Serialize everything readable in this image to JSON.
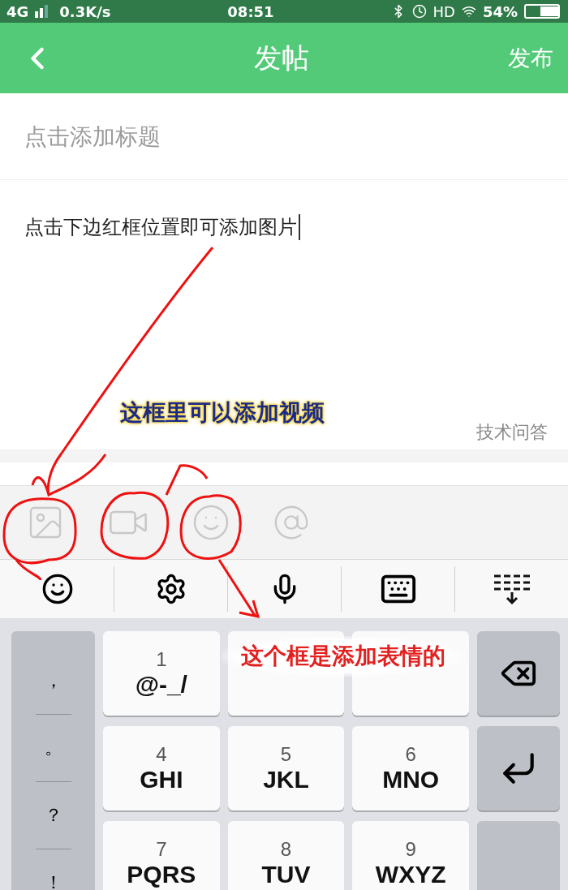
{
  "status_bar": {
    "network": "4G",
    "speed": "0.3K/s",
    "time": "08:51",
    "hd": "HD",
    "battery": "54%"
  },
  "header": {
    "title": "发帖",
    "action": "发布"
  },
  "title_field": {
    "placeholder": "点击添加标题"
  },
  "body_field": {
    "value": "点击下边红框位置即可添加图片"
  },
  "tag": "技术问答",
  "annotations": [
    {
      "kind": "blue",
      "text": "这框里可以添加视频"
    },
    {
      "kind": "red",
      "text": "这个框是添加表情的"
    }
  ],
  "keyboard": {
    "punctuation": [
      "，",
      "。",
      "？",
      "！"
    ],
    "key_rows": [
      [
        {
          "digit": "1",
          "letters": "@-_/"
        }
      ],
      [
        {
          "digit": "4",
          "letters": "GHI"
        },
        {
          "digit": "5",
          "letters": "JKL"
        },
        {
          "digit": "6",
          "letters": "MNO"
        }
      ],
      [
        {
          "digit": "7",
          "letters": "PQRS"
        },
        {
          "digit": "8",
          "letters": "TUV"
        },
        {
          "digit": "9",
          "letters": "WXYZ"
        }
      ]
    ]
  }
}
